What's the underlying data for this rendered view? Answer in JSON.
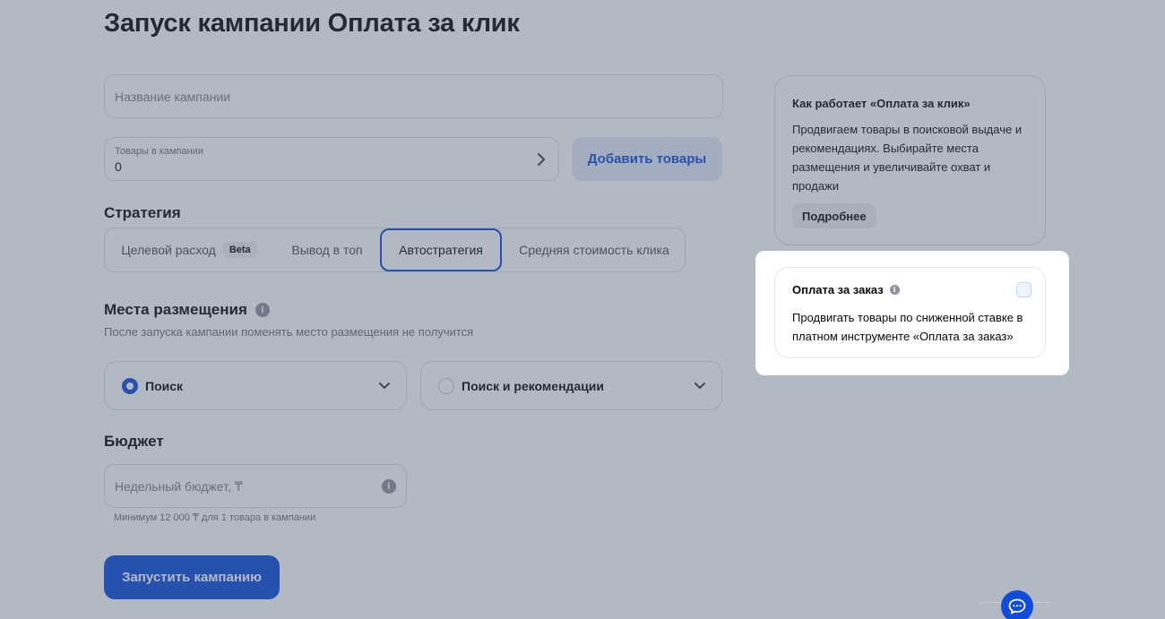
{
  "page": {
    "title": "Запуск кампании Оплата за клик"
  },
  "form": {
    "campaign_name_placeholder": "Название кампании",
    "products_label": "Товары в кампании",
    "products_value": "0",
    "add_products_label": "Добавить товары"
  },
  "strategy": {
    "title": "Стратегия",
    "items": [
      {
        "label": "Целевой расход",
        "badge": "Beta"
      },
      {
        "label": "Вывод в топ"
      },
      {
        "label": "Автостратегия",
        "active": true
      },
      {
        "label": "Средняя стоимость клика"
      }
    ]
  },
  "placement": {
    "title": "Места размещения",
    "subtitle": "После запуска кампании поменять место размещения не получится",
    "options": [
      {
        "label": "Поиск",
        "selected": true
      },
      {
        "label": "Поиск и рекомендации",
        "selected": false
      }
    ]
  },
  "budget": {
    "title": "Бюджет",
    "placeholder": "Недельный бюджет, ₸",
    "hint": "Минимум 12 000 ₸ для 1 товара в кампании"
  },
  "actions": {
    "launch_label": "Запустить кампанию"
  },
  "info_card": {
    "title": "Как работает «Оплата за клик»",
    "text": "Продвигаем товары в поисковой выдаче и рекомендациях. Выбирайте места размещения и увеличивайте охват и продажи",
    "more_label": "Подробнее"
  },
  "order_card": {
    "title": "Оплата за заказ",
    "text": "Продвигать товары по сниженной ставке в платном инструменте «Оплата за заказ»",
    "checked": false
  },
  "colors": {
    "accent": "#0f4cdc",
    "overlay": "#4a596e"
  }
}
